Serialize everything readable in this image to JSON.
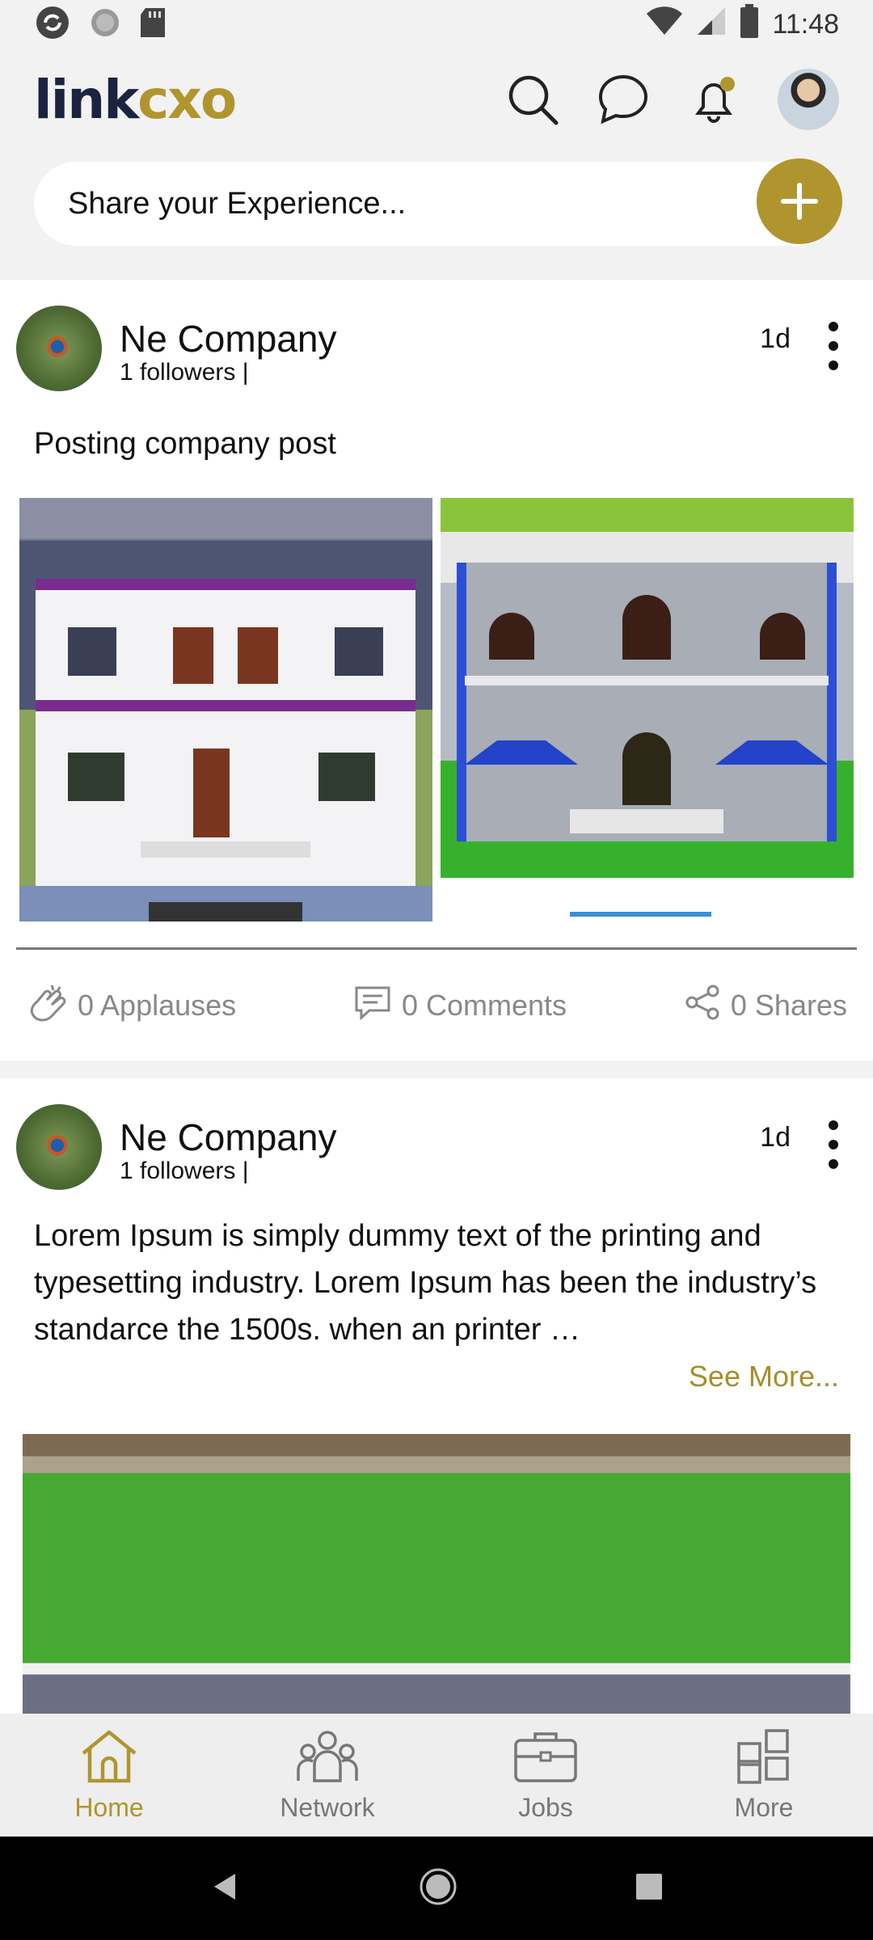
{
  "status_bar": {
    "time": "11:48"
  },
  "header": {
    "logo_part1": "link",
    "logo_part2": "cxo"
  },
  "share": {
    "placeholder": "Share your Experience..."
  },
  "posts": [
    {
      "company": "Ne Company",
      "followers": "1 followers |",
      "time": "1d",
      "text": "Posting company post",
      "actions": {
        "applauses": "0 Applauses",
        "comments": "0 Comments",
        "shares": "0 Shares"
      }
    },
    {
      "company": "Ne Company",
      "followers": "1 followers |",
      "time": "1d",
      "text": "Lorem Ipsum is simply dummy text of the printing and typesetting industry. Lorem Ipsum has been the industry’s standarce the 1500s. when an printer …",
      "see_more": "See More..."
    }
  ],
  "bottom_nav": [
    {
      "label": "Home",
      "icon": "home-icon",
      "active": true
    },
    {
      "label": "Network",
      "icon": "network-icon",
      "active": false
    },
    {
      "label": "Jobs",
      "icon": "briefcase-icon",
      "active": false
    },
    {
      "label": "More",
      "icon": "grid-icon",
      "active": false
    }
  ],
  "colors": {
    "accent": "#b0952f",
    "logo_dark": "#1c2340",
    "muted": "#888888"
  }
}
